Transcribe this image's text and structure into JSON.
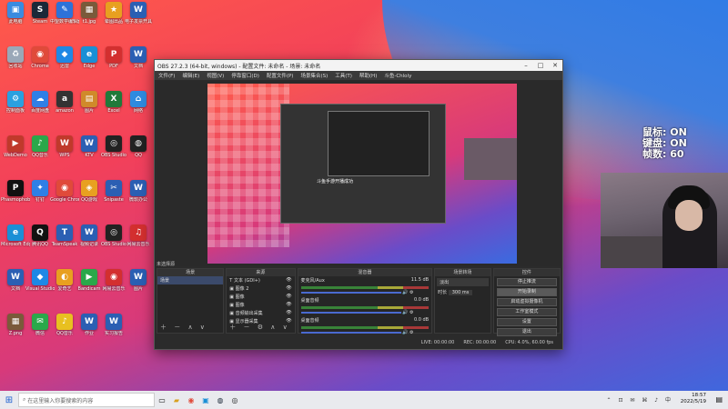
{
  "desktop_icons": [
    {
      "label": "此电脑",
      "color": "#3a8be0",
      "glyph": "▣"
    },
    {
      "label": "Steam",
      "color": "#1b2838",
      "glyph": "S"
    },
    {
      "label": "中望数学编辑器",
      "color": "#2d72d9",
      "glyph": "✎"
    },
    {
      "label": "t1.jpg",
      "color": "#7a5a3a",
      "glyph": "▦"
    },
    {
      "label": "晕图出品",
      "color": "#e8a020",
      "glyph": "★"
    },
    {
      "label": "电子发票开具",
      "color": "#2b5fb3",
      "glyph": "W"
    },
    {
      "label": "回收站",
      "color": "#9aa8b8",
      "glyph": "♻"
    },
    {
      "label": "Chrome",
      "color": "#e04a3a",
      "glyph": "◉"
    },
    {
      "label": "迅雷",
      "color": "#1e88e5",
      "glyph": "◆"
    },
    {
      "label": "Edge",
      "color": "#1a8fd6",
      "glyph": "e"
    },
    {
      "label": "PDF",
      "color": "#d32f2f",
      "glyph": "P"
    },
    {
      "label": "文档",
      "color": "#2b5fb3",
      "glyph": "W"
    },
    {
      "label": "控制面板",
      "color": "#2aa0e0",
      "glyph": "⚙"
    },
    {
      "label": "百度网盘",
      "color": "#2f7fe6",
      "glyph": "☁"
    },
    {
      "label": "amazon",
      "color": "#333333",
      "glyph": "a"
    },
    {
      "label": "图片",
      "color": "#d08a2a",
      "glyph": "▤"
    },
    {
      "label": "Excel",
      "color": "#1f7a3a",
      "glyph": "X"
    },
    {
      "label": "网络",
      "color": "#2f8be0",
      "glyph": "⌂"
    },
    {
      "label": "WebDemo",
      "color": "#c0392b",
      "glyph": "▶"
    },
    {
      "label": "QQ音乐",
      "color": "#2aa84a",
      "glyph": "♪"
    },
    {
      "label": "WPS",
      "color": "#c0392b",
      "glyph": "W"
    },
    {
      "label": "KTV",
      "color": "#2b5fb3",
      "glyph": "W"
    },
    {
      "label": "OBS Studio",
      "color": "#222222",
      "glyph": "◎"
    },
    {
      "label": "QQ",
      "color": "#222222",
      "glyph": "◍"
    },
    {
      "label": "Phasmophobia",
      "color": "#111111",
      "glyph": "P"
    },
    {
      "label": "钉钉",
      "color": "#2f7fe6",
      "glyph": "✦"
    },
    {
      "label": "Google Chrome",
      "color": "#e04a3a",
      "glyph": "◉"
    },
    {
      "label": "QQ游戏",
      "color": "#e8a020",
      "glyph": "◈"
    },
    {
      "label": "Snipaste",
      "color": "#2b5fb3",
      "glyph": "✂"
    },
    {
      "label": "微软办公",
      "color": "#2b5fb3",
      "glyph": "W"
    },
    {
      "label": "Microsoft Edge",
      "color": "#1a8fd6",
      "glyph": "e"
    },
    {
      "label": "腾讯QQ",
      "color": "#111111",
      "glyph": "Q"
    },
    {
      "label": "TeamSpeak",
      "color": "#2b5fb3",
      "glyph": "T"
    },
    {
      "label": "视频记录",
      "color": "#2b5fb3",
      "glyph": "W"
    },
    {
      "label": "OBS Studio",
      "color": "#222222",
      "glyph": "◎"
    },
    {
      "label": "网易云音乐",
      "color": "#d32f2f",
      "glyph": "♫"
    },
    {
      "label": "文档",
      "color": "#2b5fb3",
      "glyph": "W"
    },
    {
      "label": "Visual Studio Code",
      "color": "#1e88e5",
      "glyph": "◆"
    },
    {
      "label": "爱奇艺",
      "color": "#e8a020",
      "glyph": "◐"
    },
    {
      "label": "Bandicam",
      "color": "#2aa84a",
      "glyph": "▶"
    },
    {
      "label": "网易云音乐",
      "color": "#d32f2f",
      "glyph": "◉"
    },
    {
      "label": "图片",
      "color": "#2b5fb3",
      "glyph": "W"
    },
    {
      "label": "Z.png",
      "color": "#7a5a3a",
      "glyph": "▦"
    },
    {
      "label": "微信",
      "color": "#2aa84a",
      "glyph": "✉"
    },
    {
      "label": "QQ音乐",
      "color": "#e8c020",
      "glyph": "♪"
    },
    {
      "label": "作业",
      "color": "#2b5fb3",
      "glyph": "W"
    },
    {
      "label": "实习报告",
      "color": "#2b5fb3",
      "glyph": "W"
    }
  ],
  "obs": {
    "title": "OBS 27.2.3 (64-bit, windows) - 配置文件: 未命名 - 场景: 未命名",
    "menu": [
      "文件(F)",
      "编辑(E)",
      "视图(V)",
      "停靠窗口(D)",
      "配置文件(P)",
      "场景集合(S)",
      "工具(T)",
      "帮助(H)",
      "斗鱼-Chloly"
    ],
    "preview_label": "斗鱼手游开播成功",
    "docks": {
      "scenes": {
        "header": "场景",
        "items": [
          "场景"
        ]
      },
      "sources": {
        "header": "来源",
        "items": [
          "文本 (GDI+)",
          "图像 2",
          "图像",
          "图像",
          "音频输出采集",
          "显示器采集"
        ]
      },
      "mixer": {
        "header": "混音器",
        "tracks": [
          {
            "name": "麦克风/Aux",
            "level": "11.5 dB"
          },
          {
            "name": "桌面音频",
            "level": "0.0 dB"
          },
          {
            "name": "桌面音频",
            "level": "0.0 dB"
          }
        ]
      },
      "transitions": {
        "header": "场景转场",
        "mode": "淡出",
        "duration_label": "时长",
        "duration": "300 ms"
      },
      "controls": {
        "header": "控件",
        "buttons": [
          "停止推流",
          "开始录制",
          "启动虚拟摄像机",
          "工作室模式",
          "设置",
          "退出"
        ]
      }
    },
    "no_scene_label": "未选择源",
    "status": {
      "live": "LIVE: 00:00:00",
      "rec": "REC: 00:00:00",
      "cpu": "CPU: 4.0%, 60.00 fps"
    }
  },
  "overlay": {
    "line1": "鼠标: ON",
    "line2": "键盘: ON",
    "line3": "帧数: 60"
  },
  "taskbar": {
    "search_placeholder": "在这里输入你要搜索的内容",
    "time": "18:57",
    "date": "2022/5/19"
  },
  "colors": {
    "accent": "#1a5fd0",
    "obs_bg": "#2b2b2b"
  }
}
